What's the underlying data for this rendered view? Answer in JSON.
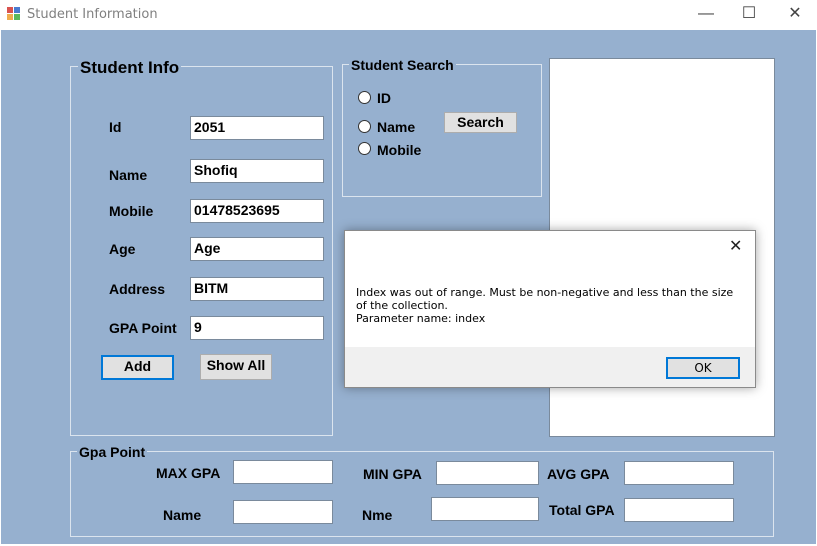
{
  "window": {
    "title": "Student Information",
    "minimize_glyph": "—",
    "maximize_glyph": "☐",
    "close_glyph": "✕"
  },
  "student_info": {
    "legend": "Student Info",
    "id_label": "Id",
    "id_value": "2051",
    "name_label": "Name",
    "name_value": "Shofiq",
    "mobile_label": "Mobile",
    "mobile_value": "01478523695",
    "age_label": "Age",
    "age_value": "Age",
    "address_label": "Address",
    "address_value": "BITM",
    "gpa_label": "GPA Point",
    "gpa_value": "9",
    "add_button": "Add",
    "show_all_button": "Show All"
  },
  "student_search": {
    "legend": "Student Search",
    "radio_id": "ID",
    "radio_name": "Name",
    "radio_mobile": "Mobile",
    "search_button": "Search"
  },
  "gpa_point": {
    "legend": "Gpa Point",
    "max_label": "MAX GPA",
    "min_label": "MIN GPA",
    "avg_label": "AVG GPA",
    "name_label": "Name",
    "nme_label": "Nme",
    "total_label": "Total GPA",
    "max_value": "",
    "min_value": "",
    "avg_value": "",
    "name_value": "",
    "nme_value": "",
    "total_value": ""
  },
  "message_box": {
    "close_glyph": "✕",
    "line1": "Index was out of range. Must be non-negative and less than the size of the collection.",
    "line2": "Parameter name: index",
    "ok_button": "OK"
  },
  "colors": {
    "client_background": "#96b0cf",
    "focus_border": "#0078d7"
  },
  "icons": {
    "app": "winforms-app-icon",
    "close": "close-icon"
  }
}
